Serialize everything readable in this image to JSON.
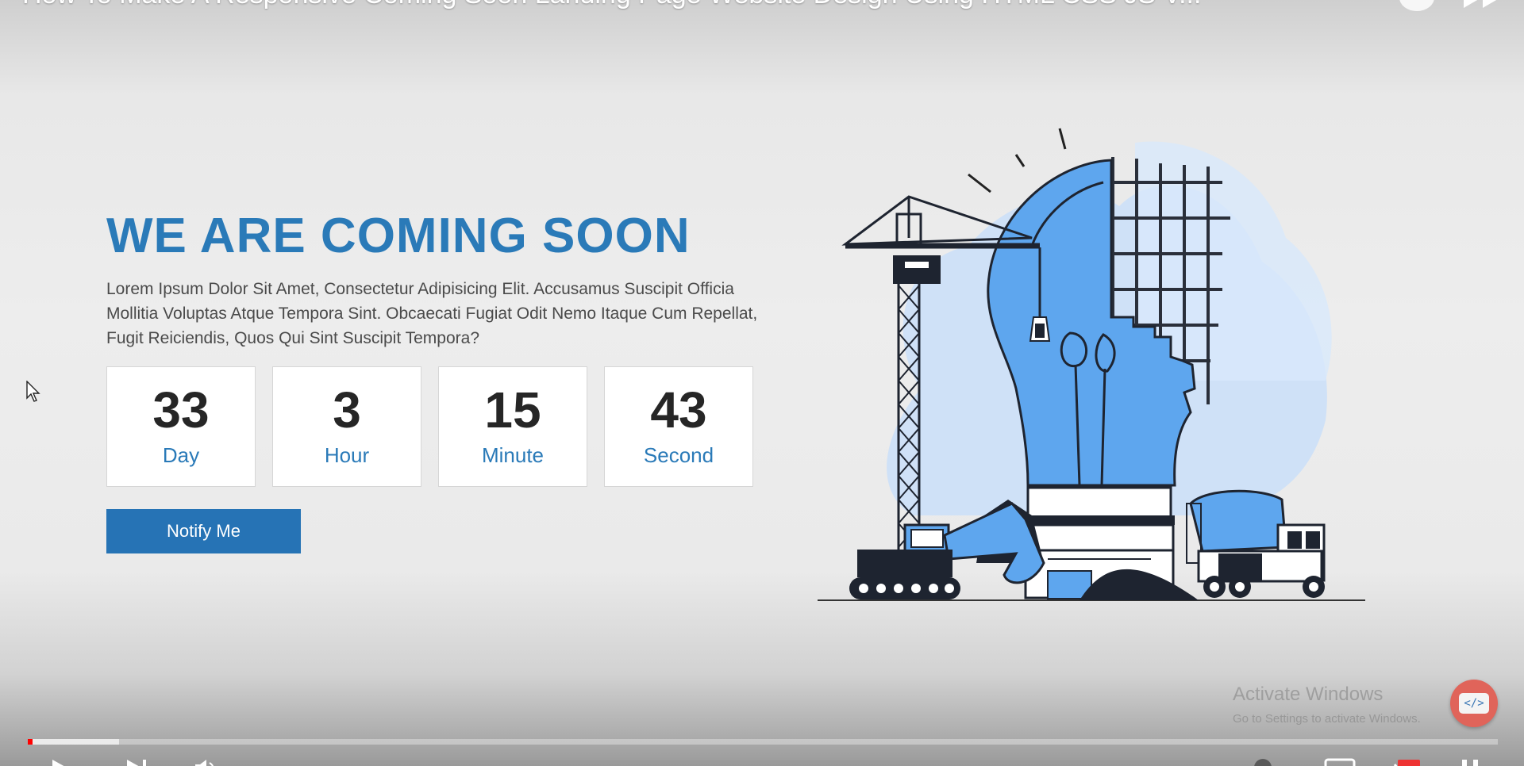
{
  "video_player": {
    "title": "How To Make A Responsive Coming Soon Landing Page Website Design Using HTML CSS JS V...",
    "progress": {
      "played_fraction": 0.003,
      "buffered_fraction": 0.062,
      "played_color": "#ff0000"
    },
    "controls": [
      "play-icon",
      "next-icon",
      "volume-icon",
      "captions-icon",
      "settings-icon",
      "fullscreen-icon"
    ]
  },
  "landing_page": {
    "title": "WE ARE COMING SOON",
    "description": "Lorem Ipsum Dolor Sit Amet, Consectetur Adipisicing Elit. Accusamus Suscipit Officia Mollitia Voluptas Atque Tempora Sint. Obcaecati Fugiat Odit Nemo Itaque Cum Repellat, Fugit Reiciendis, Quos Qui Sint Suscipit Tempora?",
    "countdown": [
      {
        "value": "33",
        "label": "Day"
      },
      {
        "value": "3",
        "label": "Hour"
      },
      {
        "value": "15",
        "label": "Minute"
      },
      {
        "value": "43",
        "label": "Second"
      }
    ],
    "notify_button": "Notify Me",
    "accent_color": "#2a7ab8",
    "illustration": "construction-lightbulb-illustration"
  },
  "windows_watermark": {
    "title": "Activate Windows",
    "subtitle": "Go to Settings to activate Windows."
  },
  "channel_badge_icon": "code-icon"
}
